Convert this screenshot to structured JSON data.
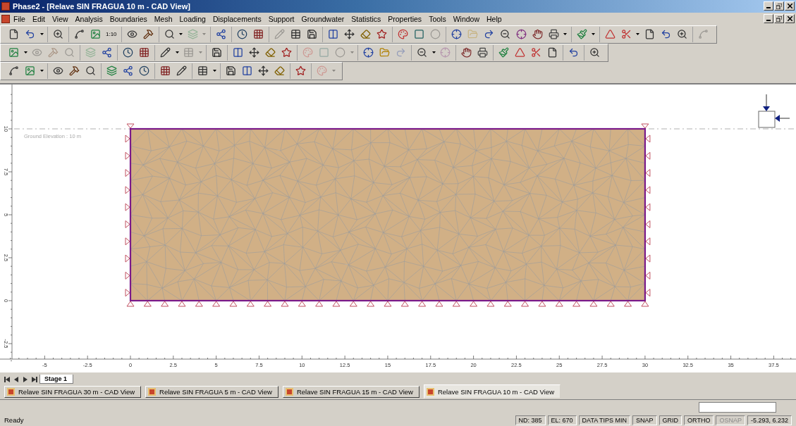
{
  "window": {
    "title": "Phase2 - [Relave SIN FRAGUA 10 m - CAD View]"
  },
  "menu": [
    "File",
    "Edit",
    "View",
    "Analysis",
    "Boundaries",
    "Mesh",
    "Loading",
    "Displacements",
    "Support",
    "Groundwater",
    "Statistics",
    "Properties",
    "Tools",
    "Window",
    "Help"
  ],
  "toolbars": [
    [
      [
        {
          "kind": "icon",
          "disabled": false
        },
        {
          "kind": "icon",
          "disabled": false
        },
        {
          "kind": "dropdown",
          "disabled": false
        }
      ],
      [
        {
          "kind": "icon",
          "disabled": false
        }
      ],
      [
        {
          "kind": "icon",
          "disabled": false
        },
        {
          "kind": "icon",
          "disabled": false
        },
        {
          "kind": "text",
          "label": "1:10",
          "disabled": false
        }
      ],
      [
        {
          "kind": "icon",
          "disabled": false
        },
        {
          "kind": "icon",
          "disabled": false
        }
      ],
      [
        {
          "kind": "icon",
          "disabled": false
        },
        {
          "kind": "dropdown",
          "disabled": false
        },
        {
          "kind": "icon",
          "disabled": true
        },
        {
          "kind": "dropdown",
          "disabled": true
        }
      ],
      [
        {
          "kind": "icon",
          "disabled": false
        }
      ],
      [
        {
          "kind": "icon",
          "disabled": false
        },
        {
          "kind": "icon",
          "disabled": false
        }
      ],
      [
        {
          "kind": "icon",
          "disabled": true
        },
        {
          "kind": "icon",
          "disabled": false
        },
        {
          "kind": "icon",
          "disabled": false
        }
      ],
      [
        {
          "kind": "icon",
          "disabled": false
        },
        {
          "kind": "icon",
          "disabled": false
        },
        {
          "kind": "icon",
          "disabled": false
        },
        {
          "kind": "icon",
          "disabled": false
        }
      ],
      [
        {
          "kind": "icon",
          "disabled": false
        },
        {
          "kind": "icon",
          "disabled": false
        },
        {
          "kind": "icon",
          "disabled": true
        }
      ],
      [
        {
          "kind": "icon",
          "disabled": false
        },
        {
          "kind": "icon",
          "disabled": true
        },
        {
          "kind": "icon",
          "disabled": false
        },
        {
          "kind": "icon",
          "disabled": false
        },
        {
          "kind": "icon",
          "disabled": false
        },
        {
          "kind": "icon",
          "disabled": false
        },
        {
          "kind": "icon",
          "disabled": false
        },
        {
          "kind": "dropdown",
          "disabled": false
        }
      ],
      [
        {
          "kind": "icon",
          "disabled": false
        },
        {
          "kind": "dropdown",
          "disabled": false
        }
      ],
      [
        {
          "kind": "icon",
          "disabled": false
        },
        {
          "kind": "icon",
          "disabled": false
        },
        {
          "kind": "dropdown",
          "disabled": false
        },
        {
          "kind": "icon",
          "disabled": false
        },
        {
          "kind": "icon",
          "disabled": false
        },
        {
          "kind": "icon",
          "disabled": false
        }
      ],
      [
        {
          "kind": "icon",
          "disabled": true
        }
      ]
    ],
    [
      [
        {
          "kind": "icon",
          "disabled": false
        },
        {
          "kind": "dropdown",
          "disabled": false
        },
        {
          "kind": "icon",
          "disabled": true
        },
        {
          "kind": "icon",
          "disabled": true
        },
        {
          "kind": "icon",
          "disabled": true
        }
      ],
      [
        {
          "kind": "icon",
          "disabled": true
        },
        {
          "kind": "icon",
          "disabled": false
        }
      ],
      [
        {
          "kind": "icon",
          "disabled": false
        },
        {
          "kind": "icon",
          "disabled": false
        }
      ],
      [
        {
          "kind": "icon",
          "disabled": false
        },
        {
          "kind": "dropdown",
          "disabled": false
        },
        {
          "kind": "icon",
          "disabled": true
        },
        {
          "kind": "dropdown",
          "disabled": true
        }
      ],
      [
        {
          "kind": "icon",
          "disabled": false
        }
      ],
      [
        {
          "kind": "icon",
          "disabled": false
        },
        {
          "kind": "icon",
          "disabled": false
        },
        {
          "kind": "icon",
          "disabled": false
        },
        {
          "kind": "icon",
          "disabled": false
        }
      ],
      [
        {
          "kind": "icon",
          "disabled": true
        },
        {
          "kind": "icon",
          "disabled": true
        },
        {
          "kind": "icon",
          "disabled": true
        },
        {
          "kind": "dropdown",
          "disabled": true
        }
      ],
      [
        {
          "kind": "icon",
          "disabled": false
        },
        {
          "kind": "icon",
          "disabled": false
        },
        {
          "kind": "icon",
          "disabled": true
        }
      ],
      [
        {
          "kind": "icon",
          "disabled": false
        },
        {
          "kind": "dropdown",
          "disabled": false
        },
        {
          "kind": "icon",
          "disabled": true
        }
      ],
      [
        {
          "kind": "icon",
          "disabled": false
        },
        {
          "kind": "icon",
          "disabled": false
        }
      ],
      [
        {
          "kind": "icon",
          "disabled": false
        },
        {
          "kind": "icon",
          "disabled": false
        },
        {
          "kind": "icon",
          "disabled": false
        },
        {
          "kind": "icon",
          "disabled": false
        }
      ],
      [
        {
          "kind": "icon",
          "disabled": false
        }
      ],
      [
        {
          "kind": "icon",
          "disabled": false
        }
      ]
    ],
    [
      [
        {
          "kind": "icon",
          "disabled": false
        },
        {
          "kind": "icon",
          "disabled": false
        },
        {
          "kind": "dropdown",
          "disabled": false
        }
      ],
      [
        {
          "kind": "icon",
          "disabled": false
        },
        {
          "kind": "icon",
          "disabled": false
        },
        {
          "kind": "icon",
          "disabled": false
        }
      ],
      [
        {
          "kind": "icon",
          "disabled": false
        },
        {
          "kind": "icon",
          "disabled": false
        },
        {
          "kind": "icon",
          "disabled": false
        }
      ],
      [
        {
          "kind": "icon",
          "disabled": false
        },
        {
          "kind": "icon",
          "disabled": false
        }
      ],
      [
        {
          "kind": "icon",
          "disabled": false
        },
        {
          "kind": "dropdown",
          "disabled": false
        }
      ],
      [
        {
          "kind": "icon",
          "disabled": false
        },
        {
          "kind": "icon",
          "disabled": false
        },
        {
          "kind": "icon",
          "disabled": false
        },
        {
          "kind": "icon",
          "disabled": false
        }
      ],
      [
        {
          "kind": "icon",
          "disabled": false
        }
      ],
      [
        {
          "kind": "icon",
          "disabled": true
        },
        {
          "kind": "dropdown",
          "disabled": true
        }
      ]
    ]
  ],
  "canvas": {
    "ground_label": "Ground Elevation : 10 m",
    "x_ruler": [
      "-5",
      "-2.5",
      "0",
      "2.5",
      "5",
      "7.5",
      "10",
      "12.5",
      "15",
      "17.5",
      "20",
      "22.5",
      "25",
      "27.5",
      "30",
      "32.5",
      "35",
      "37.5"
    ],
    "y_ruler": [
      "10",
      "7.5",
      "5",
      "2.5",
      "0",
      "-2.5"
    ]
  },
  "stage_tabs": [
    {
      "label": "Stage 1",
      "selected": true
    }
  ],
  "document_tabs": [
    {
      "label": "Relave SIN FRAGUA 30 m - CAD View",
      "selected": false
    },
    {
      "label": "Relave SIN FRAGUA 5 m - CAD View",
      "selected": false
    },
    {
      "label": "Relave SIN FRAGUA 15 m - CAD View",
      "selected": false
    },
    {
      "label": "Relave SIN FRAGUA 10 m - CAD View",
      "selected": true
    }
  ],
  "status_bar": {
    "message": "Ready",
    "panes": [
      {
        "label": "ND: 385",
        "enabled": true
      },
      {
        "label": "EL: 670",
        "enabled": true
      },
      {
        "label": "DATA TIPS MIN",
        "enabled": true
      },
      {
        "label": "SNAP",
        "enabled": true
      },
      {
        "label": "GRID",
        "enabled": true
      },
      {
        "label": "ORTHO",
        "enabled": true
      },
      {
        "label": "OSNAP",
        "enabled": false
      },
      {
        "label": "-5.293, 6.232",
        "enabled": true
      }
    ]
  }
}
